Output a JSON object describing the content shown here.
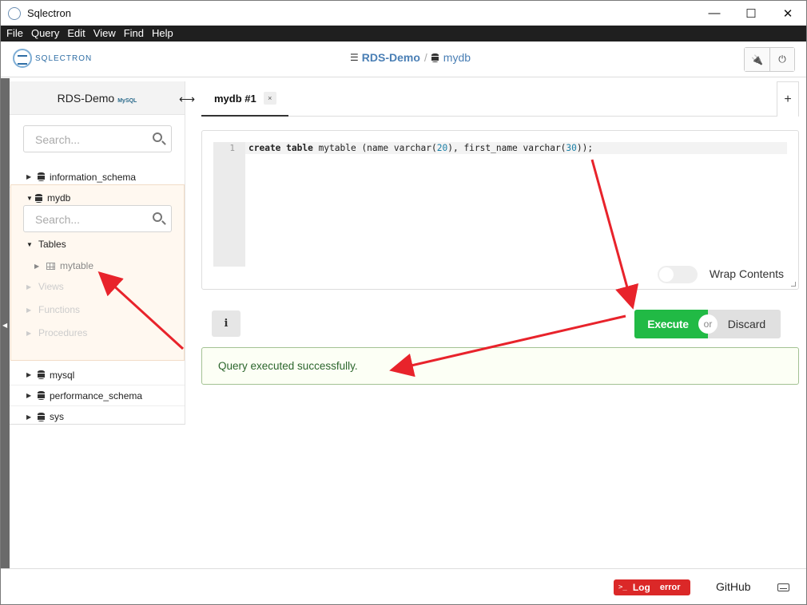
{
  "window": {
    "title": "Sqlectron",
    "minimize": "—",
    "maximize": "☐",
    "close": "✕"
  },
  "menu": [
    "File",
    "Query",
    "Edit",
    "View",
    "Find",
    "Help"
  ],
  "header": {
    "logo_text": "SQLECTRON",
    "server": "RDS-Demo",
    "separator": "/",
    "database": "mydb",
    "plug_icon": "🔌",
    "power_icon": "⏻"
  },
  "sidebar": {
    "server_name": "RDS-Demo",
    "server_badge": "MySQL",
    "search_placeholder": "Search...",
    "databases_top": [
      "information_schema"
    ],
    "expanded_db": {
      "name": "mydb",
      "search_placeholder": "Search...",
      "tables_label": "Tables",
      "tables": [
        "mytable"
      ],
      "views_label": "Views",
      "functions_label": "Functions",
      "procedures_label": "Procedures"
    },
    "databases_bottom": [
      "mysql",
      "performance_schema",
      "sys"
    ]
  },
  "tabs": {
    "active": "mydb #1",
    "close": "×",
    "add": "+"
  },
  "editor": {
    "line_number": "1",
    "kw1": "create table",
    "t1": " mytable (name varchar(",
    "n1": "20",
    "t2": "), first_name varchar(",
    "n2": "30",
    "t3": "));",
    "wrap_label": "Wrap Contents"
  },
  "actions": {
    "info": "i",
    "execute": "Execute",
    "or": "or",
    "discard": "Discard"
  },
  "status": {
    "message": "Query executed successfully."
  },
  "footer": {
    "log_prompt": ">_",
    "log_label": "Log",
    "log_badge": "error",
    "github": "GitHub"
  },
  "colors": {
    "execute": "#21ba45",
    "log": "#db2828",
    "success_border": "#a3c293",
    "annotation_arrow": "#e8232b"
  }
}
